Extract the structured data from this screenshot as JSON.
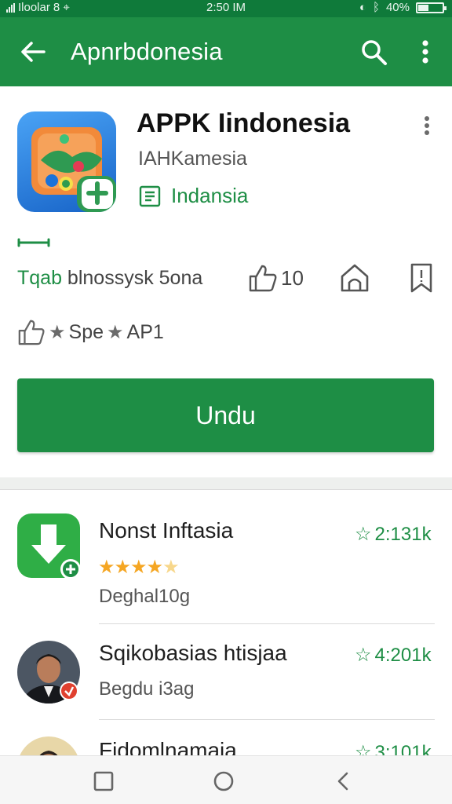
{
  "status_bar": {
    "carrier": "Iloolar",
    "carrier_extra": "8 ⌖",
    "time": "2:50 IM",
    "battery_text": "40%",
    "battery_level": 0.4
  },
  "app_bar": {
    "title": "Apnrbdonesia",
    "back_icon": "arrow-left-icon",
    "search_icon": "search-icon",
    "menu_icon": "more-vert-icon"
  },
  "app": {
    "name": "APPK Iindonesia",
    "developer": "IAHKamesia",
    "category": "Indansia"
  },
  "stats": {
    "label_accent": "Tqab",
    "label_rest": " blnossysk 5ona",
    "likes": "10"
  },
  "meta": {
    "text_1": "Spe",
    "text_2": "AP1"
  },
  "install_button": "Undu",
  "list": [
    {
      "title": "Nonst Inftasia",
      "subtitle": "Deghal10g",
      "rating": "2:131k",
      "stars": 4.5
    },
    {
      "title": "Sqikobasias htisjaa",
      "subtitle": "Begdu i3ag",
      "rating": "4:201k"
    },
    {
      "title": "Fidomlnamaia",
      "subtitle": "",
      "rating": "3:101k"
    }
  ],
  "colors": {
    "primary": "#1e8e45",
    "status_bar": "#0f7a3a",
    "star": "#f5a623"
  }
}
